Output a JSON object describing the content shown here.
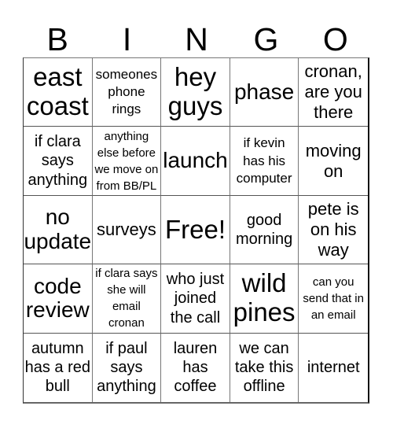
{
  "header": {
    "letters": [
      "B",
      "I",
      "N",
      "G",
      "O"
    ]
  },
  "cells": [
    {
      "text": "east coast",
      "size": "s-xl"
    },
    {
      "text": "someones phone rings",
      "size": "s-s"
    },
    {
      "text": "hey guys",
      "size": "s-xl"
    },
    {
      "text": "phase",
      "size": "s-l"
    },
    {
      "text": "cronan, are you there",
      "size": "s-m"
    },
    {
      "text": "if clara says anything",
      "size": "s-ms"
    },
    {
      "text": "anything else before we move on from BB/PL",
      "size": "s-xs"
    },
    {
      "text": "launch",
      "size": "s-l"
    },
    {
      "text": "if kevin has his computer",
      "size": "s-s"
    },
    {
      "text": "moving on",
      "size": "s-m"
    },
    {
      "text": "no update",
      "size": "s-l"
    },
    {
      "text": "surveys",
      "size": "s-m"
    },
    {
      "text": "Free!",
      "size": "s-xl"
    },
    {
      "text": "good morning",
      "size": "s-ms"
    },
    {
      "text": "pete is on his way",
      "size": "s-m"
    },
    {
      "text": "code review",
      "size": "s-l"
    },
    {
      "text": "if clara says she will email cronan",
      "size": "s-xs"
    },
    {
      "text": "who just joined the call",
      "size": "s-ms"
    },
    {
      "text": "wild pines",
      "size": "s-xl"
    },
    {
      "text": "can you send that in an email",
      "size": "s-xs"
    },
    {
      "text": "autumn has a red bull",
      "size": "s-ms"
    },
    {
      "text": "if paul says anything",
      "size": "s-ms"
    },
    {
      "text": "lauren has coffee",
      "size": "s-ms"
    },
    {
      "text": "we can take this offline",
      "size": "s-ms"
    },
    {
      "text": "internet",
      "size": "s-ms"
    }
  ]
}
